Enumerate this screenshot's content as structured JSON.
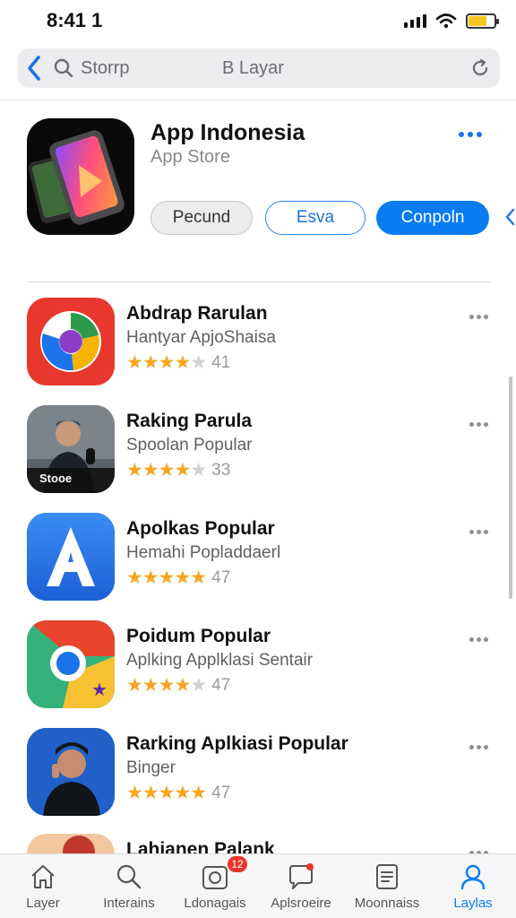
{
  "status": {
    "time": "8:41 1"
  },
  "url_bar": {
    "placeholder": "Storrp",
    "title": "B Layar"
  },
  "hero": {
    "title": "App Indonesia",
    "subtitle": "App Store",
    "buttons": {
      "gray": "Pecund",
      "outline": "Esva",
      "primary": "Conpoln"
    }
  },
  "apps": [
    {
      "title": "Abdrap Rarulan",
      "subtitle": "Hantyar  ApjoShaisa",
      "rating": "41",
      "stars": 4
    },
    {
      "title": "Raking Parula",
      "subtitle": "Spoolan Popular",
      "rating": "33",
      "stars": 4,
      "icon_caption": "Stooe"
    },
    {
      "title": "Apolkas  Popular",
      "subtitle": "Hemahi  Popladdaerl",
      "rating": "47",
      "stars": 4.5
    },
    {
      "title": "Poidum Popular",
      "subtitle": "Aplking  Applklasi Sentair",
      "rating": "47",
      "stars": 4
    },
    {
      "title": "Rarking Aplkiasi Popular",
      "subtitle": "Binger",
      "rating": "47",
      "stars": 5
    },
    {
      "title": "Lahianen Palank"
    }
  ],
  "tabs": [
    {
      "label": "Layer",
      "icon": "home-icon"
    },
    {
      "label": "Interains",
      "icon": "search-icon"
    },
    {
      "label": "Ldonagais",
      "icon": "camera-icon",
      "badge": "12"
    },
    {
      "label": "Aplsroeire",
      "icon": "chat-icon"
    },
    {
      "label": "Moonnaiss",
      "icon": "document-icon"
    },
    {
      "label": "Laylas",
      "icon": "profile-icon"
    }
  ],
  "colors": {
    "accent": "#0a7cf2",
    "star": "#f5a623",
    "badge": "#e8362d"
  }
}
